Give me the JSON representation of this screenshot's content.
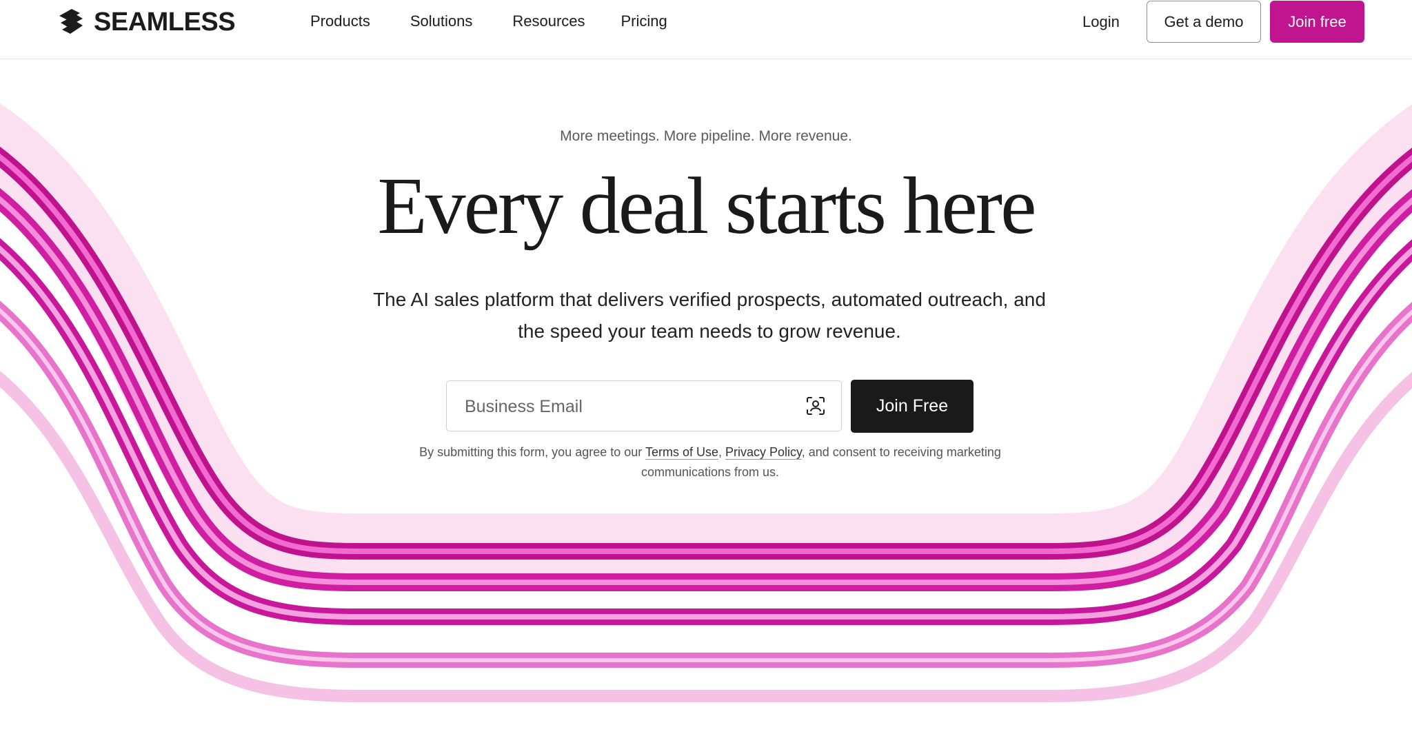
{
  "brand": {
    "name": "SEAMLESS",
    "accent_color": "#c1148f"
  },
  "header": {
    "nav": [
      {
        "label": "Products"
      },
      {
        "label": "Solutions"
      },
      {
        "label": "Resources"
      },
      {
        "label": "Pricing"
      }
    ],
    "login_label": "Login",
    "demo_label": "Get a demo",
    "join_label": "Join free"
  },
  "hero": {
    "tagline": "More meetings. More pipeline. More revenue.",
    "headline": "Every deal starts here",
    "subtitle": "The AI sales platform that delivers verified prospects, automated outreach, and the speed your team needs to grow revenue.",
    "email_placeholder": "Business Email",
    "email_icon": "contact-scan-icon",
    "submit_label": "Join Free",
    "disclaimer": {
      "prefix": "By submitting this form, you agree to our ",
      "terms_label": "Terms of Use",
      "separator": ", ",
      "privacy_label": "Privacy Policy",
      "suffix": ", and consent to receiving marketing communications from us."
    }
  }
}
